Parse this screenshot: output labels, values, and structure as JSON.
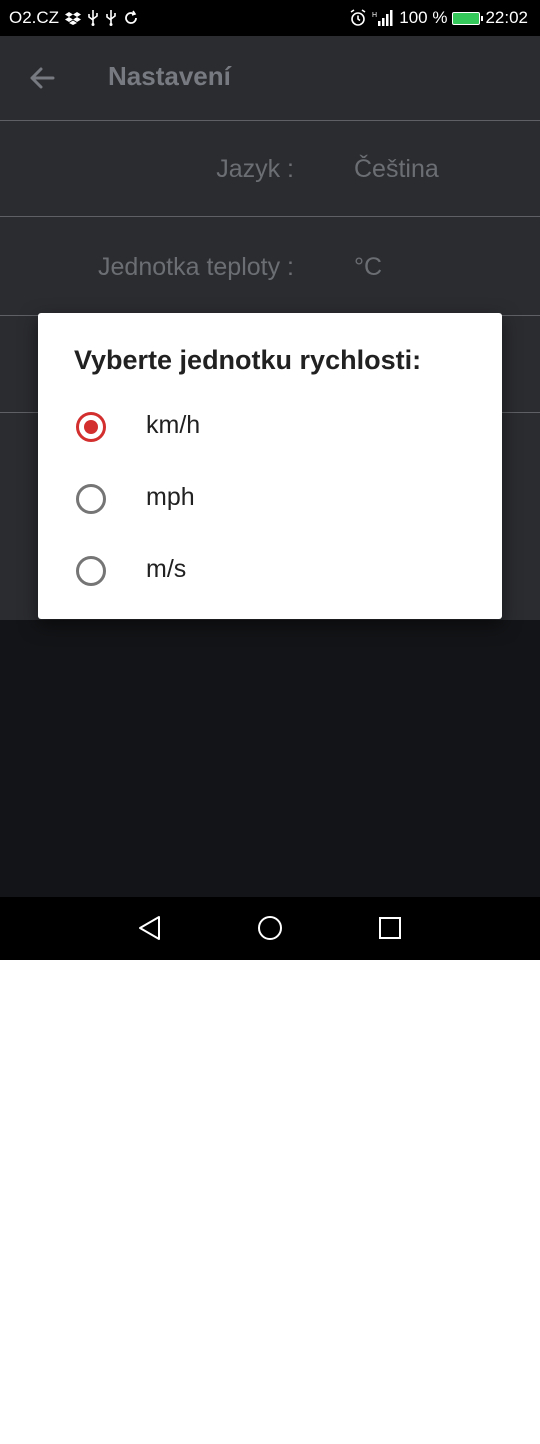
{
  "status_bar": {
    "carrier": "O2.CZ",
    "battery": "100 %",
    "battery_level": 1.0,
    "time": "22:02",
    "left_icons": [
      "dropbox-icon",
      "usb-icon",
      "usb-icon",
      "sync-icon"
    ],
    "right_icons": [
      "alarm-icon",
      "signal-icon",
      "battery-icon"
    ]
  },
  "app_bar": {
    "title": "Nastavení",
    "back_icon": "arrow-left-icon"
  },
  "settings": {
    "rows": [
      {
        "label": "Jazyk :",
        "value": "Čeština"
      },
      {
        "label": "Jednotka teploty :",
        "value": "°C"
      }
    ]
  },
  "dialog": {
    "title": "Vyberte jednotku rychlosti:",
    "options": [
      {
        "label": "km/h",
        "selected": true
      },
      {
        "label": "mph",
        "selected": false
      },
      {
        "label": "m/s",
        "selected": false
      }
    ],
    "accent_color": "#d32f2f"
  },
  "nav_bar": {
    "icons": [
      "back-triangle-icon",
      "home-circle-icon",
      "recents-square-icon"
    ]
  }
}
